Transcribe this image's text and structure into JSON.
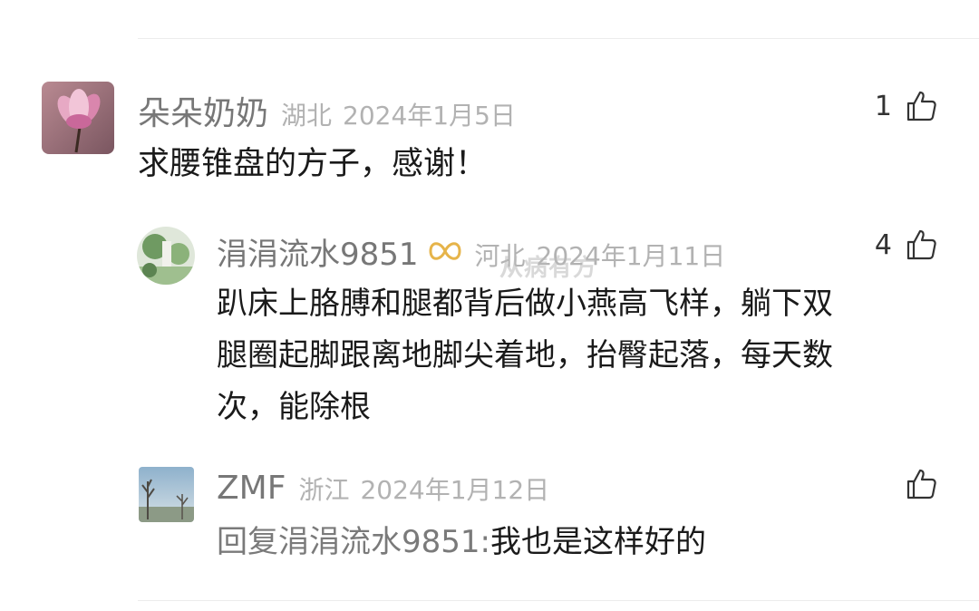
{
  "comments": [
    {
      "user": "朵朵奶奶",
      "region": "湖北",
      "date": "2024年1月5日",
      "likes": "1",
      "text": "求腰锥盘的方子，感谢！",
      "avatar_icon": "magnolia-flower-avatar"
    },
    {
      "user": "涓涓流水9851",
      "region": "河北",
      "date": "2024年1月11日",
      "likes": "4",
      "text_lines": [
        "趴床上胳膊和腿都背后做小燕高飞样，躺下双",
        "腿圈起脚跟离地脚尖着地，抬臀起落，每天数",
        "次，能除根"
      ],
      "badge_icon": "infinity-badge-icon",
      "avatar_icon": "scenery-avatar"
    },
    {
      "user": "ZMF",
      "region": "浙江",
      "date": "2024年1月12日",
      "likes": "",
      "reply_prefix": "回复涓涓流水9851:",
      "reply_text": "我也是这样好的",
      "avatar_icon": "winter-tree-avatar"
    }
  ],
  "watermark": "从病有方",
  "colors": {
    "name": "#777777",
    "meta": "#b2b2b2",
    "text": "#1a1a1a",
    "divider": "#ececec"
  }
}
